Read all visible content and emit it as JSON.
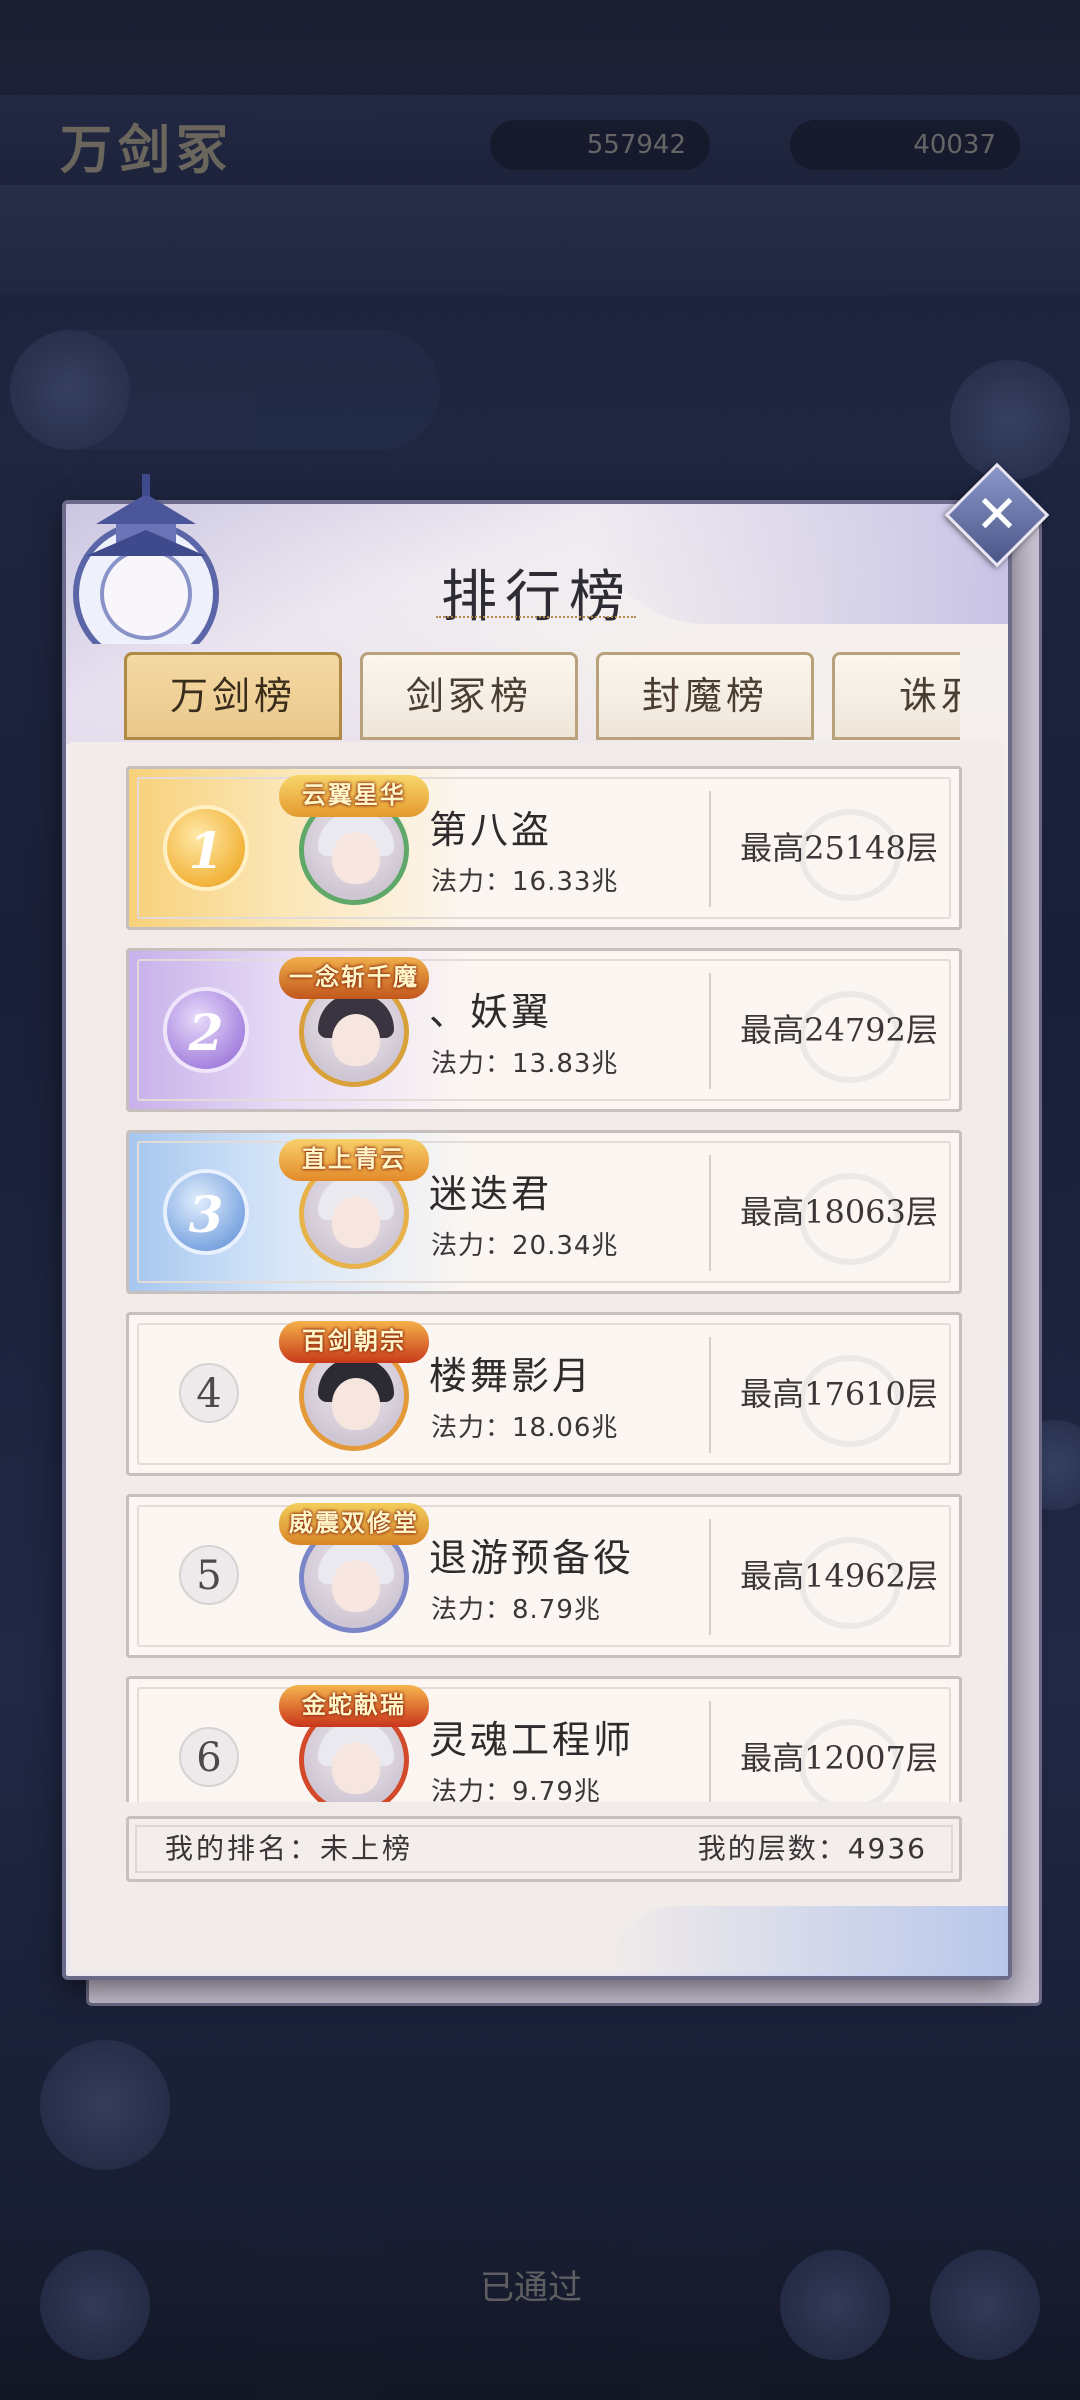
{
  "background": {
    "title": "万剑冢",
    "currency1": "557942",
    "currency2": "40037",
    "bottom_label": "已通过"
  },
  "modal": {
    "title": "排行榜",
    "tabs": [
      {
        "label": "万剑榜",
        "active": true
      },
      {
        "label": "剑冢榜",
        "active": false
      },
      {
        "label": "封魔榜",
        "active": false
      },
      {
        "label": "诛邪",
        "active": false
      }
    ],
    "entries": [
      {
        "rank": "1",
        "badge": "云翼星华",
        "name": "第八盗",
        "power": "法力：16.33兆",
        "best": "最高25148层"
      },
      {
        "rank": "2",
        "badge": "一念斩千魔",
        "name": "、妖翼",
        "power": "法力：13.83兆",
        "best": "最高24792层"
      },
      {
        "rank": "3",
        "badge": "直上青云",
        "name": "迷迭君",
        "power": "法力：20.34兆",
        "best": "最高18063层"
      },
      {
        "rank": "4",
        "badge": "百剑朝宗",
        "name": "楼舞影月",
        "power": "法力：18.06兆",
        "best": "最高17610层"
      },
      {
        "rank": "5",
        "badge": "威震双修堂",
        "name": "退游预备役",
        "power": "法力：8.79兆",
        "best": "最高14962层"
      },
      {
        "rank": "6",
        "badge": "金蛇献瑞",
        "name": "灵魂工程师",
        "power": "法力：9.79兆",
        "best": "最高12007层"
      }
    ],
    "my_rank": "我的排名：未上榜",
    "my_floor": "我的层数：4936"
  },
  "colors": {
    "accent_gold": "#f2b43c",
    "accent_purple": "#a886df",
    "accent_blue": "#7fa8e2",
    "frame": "#6b6a8a"
  }
}
